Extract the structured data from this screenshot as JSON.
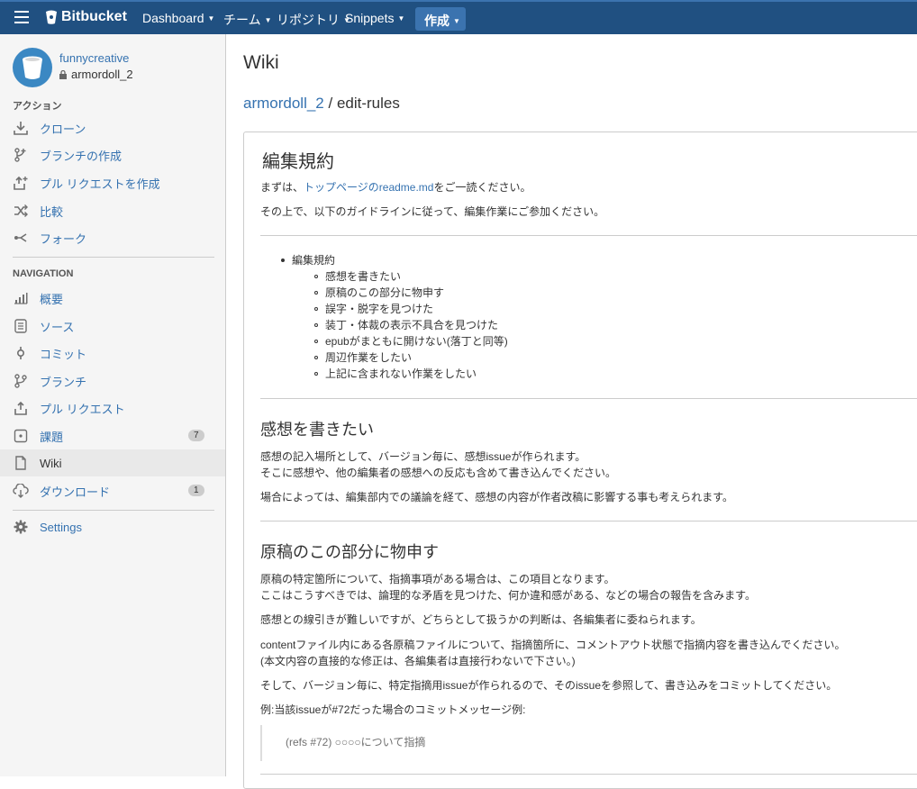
{
  "topbar": {
    "logo": "Bitbucket",
    "nav": [
      {
        "label": "Dashboard"
      },
      {
        "label": "チーム"
      },
      {
        "label": "リポジトリ"
      },
      {
        "label": "Snippets"
      }
    ],
    "create_label": "作成",
    "bg_color": "#205081"
  },
  "sidebar": {
    "owner": "funnycreative",
    "repo": "armordoll_2",
    "actions_heading": "アクション",
    "actions": [
      {
        "label": "クローン",
        "icon": "download-icon"
      },
      {
        "label": "ブランチの作成",
        "icon": "branch-create-icon"
      },
      {
        "label": "プル リクエストを作成",
        "icon": "pull-request-create-icon"
      },
      {
        "label": "比較",
        "icon": "compare-icon"
      },
      {
        "label": "フォーク",
        "icon": "fork-icon"
      }
    ],
    "nav_heading": "NAVIGATION",
    "nav": [
      {
        "label": "概要",
        "icon": "bar-chart-icon"
      },
      {
        "label": "ソース",
        "icon": "source-icon"
      },
      {
        "label": "コミット",
        "icon": "commit-icon"
      },
      {
        "label": "ブランチ",
        "icon": "branch-icon"
      },
      {
        "label": "プル リクエスト",
        "icon": "pull-request-icon"
      },
      {
        "label": "課題",
        "icon": "issue-icon",
        "badge": "7"
      },
      {
        "label": "Wiki",
        "icon": "wiki-page-icon",
        "active": true
      },
      {
        "label": "ダウンロード",
        "icon": "cloud-download-icon",
        "badge": "1"
      }
    ],
    "settings": {
      "label": "Settings",
      "icon": "gear-icon"
    }
  },
  "main": {
    "title": "Wiki",
    "breadcrumb_repo": "armordoll_2",
    "breadcrumb_sep": " / ",
    "breadcrumb_page": "edit-rules",
    "doc": {
      "h1": "編集規約",
      "intro1_pre": "まずは、",
      "intro1_link": "トップページのreadme.md",
      "intro1_post": "をご一読ください。",
      "intro2": "その上で、以下のガイドラインに従って、編集作業にご参加ください。",
      "toc_top": "編集規約",
      "toc": [
        "感想を書きたい",
        "原稿のこの部分に物申す",
        "誤字・脱字を見つけた",
        "装丁・体裁の表示不具合を見つけた",
        "epubがまともに開けない(落丁と同等)",
        "周辺作業をしたい",
        "上記に含まれない作業をしたい"
      ],
      "s1_title": "感想を書きたい",
      "s1_p1": "感想の記入場所として、バージョン毎に、感想issueが作られます。",
      "s1_p2": "そこに感想や、他の編集者の感想への反応も含めて書き込んでください。",
      "s1_p3": "場合によっては、編集部内での議論を経て、感想の内容が作者改稿に影響する事も考えられます。",
      "s2_title": "原稿のこの部分に物申す",
      "s2_p1": "原稿の特定箇所について、指摘事項がある場合は、この項目となります。",
      "s2_p2": "ここはこうすべきでは、論理的な矛盾を見つけた、何か違和感がある、などの場合の報告を含みます。",
      "s2_p3": "感想との線引きが難しいですが、どちらとして扱うかの判断は、各編集者に委ねられます。",
      "s2_p4": "contentファイル内にある各原稿ファイルについて、指摘箇所に、コメントアウト状態で指摘内容を書き込んでください。",
      "s2_p5": "(本文内容の直接的な修正は、各編集者は直接行わないで下さい。)",
      "s2_p6": "そして、バージョン毎に、特定指摘用issueが作られるので、そのissueを参照して、書き込みをコミットしてください。",
      "s2_p7": "例:当該issueが#72だった場合のコミットメッセージ例:",
      "s2_quote": "(refs #72) ○○○○について指摘"
    }
  }
}
